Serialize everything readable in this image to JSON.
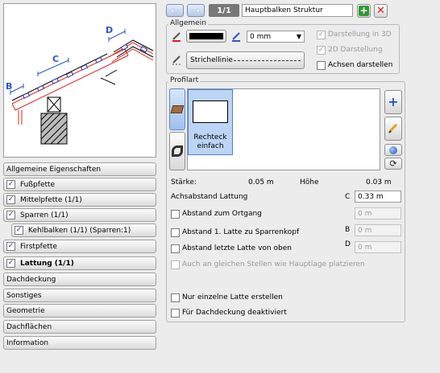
{
  "header": {
    "page_indicator": "1/1",
    "title_value": "Hauptbalken Struktur",
    "back_icon": "arrow-left-icon",
    "forward_icon": "arrow-right-icon",
    "add_icon": "plus-icon",
    "delete_icon": "x-icon"
  },
  "preview": {
    "labels": {
      "a": "A",
      "b": "B",
      "c": "C",
      "d": "D"
    }
  },
  "sidebar": {
    "items": [
      {
        "label": "Allgemeine Eigenschaften",
        "checkbox": false,
        "bold": false
      },
      {
        "label": "Fußpfette",
        "checkbox": true,
        "checked": true,
        "bold": false
      },
      {
        "label": "Mittelpfette (1/1)",
        "checkbox": true,
        "checked": true,
        "bold": false
      },
      {
        "label": "Sparren (1/1)",
        "checkbox": true,
        "checked": true,
        "bold": false
      },
      {
        "label": "Kehlbalken (1/1) (Sparren:1)",
        "checkbox": true,
        "checked": true,
        "bold": false
      },
      {
        "label": "Firstpfette",
        "checkbox": true,
        "checked": true,
        "bold": false
      },
      {
        "label": "Lattung (1/1)",
        "checkbox": true,
        "checked": true,
        "bold": true
      },
      {
        "label": "Dachdeckung",
        "checkbox": false,
        "bold": false
      },
      {
        "label": "Sonstiges",
        "checkbox": false,
        "bold": false
      },
      {
        "label": "Geometrie",
        "checkbox": false,
        "bold": false
      },
      {
        "label": "Dachflächen",
        "checkbox": false,
        "bold": false
      },
      {
        "label": "Information",
        "checkbox": false,
        "bold": false
      }
    ]
  },
  "allgemein": {
    "title": "Allgemein",
    "pen_color": "#000000",
    "pen_width_value": "0 mm",
    "line_style_label": "Strichellinie",
    "darstellung_3d": "Darstellung in 3D",
    "darstellung_2d": "2D Darstellung",
    "achsen": "Achsen darstellen"
  },
  "profilart": {
    "title": "Profilart",
    "tile_line1": "Rechteck",
    "tile_line2": "einfach",
    "staerke_label": "Stärke:",
    "staerke_value": "0.05 m",
    "hoehe_label": "Höhe",
    "hoehe_value": "0.03 m"
  },
  "options": {
    "achsabstand_label": "Achsabstand Lattung",
    "achsabstand_letter": "C",
    "achsabstand_value": "0.33 m",
    "ortgang_label": "Abstand zum Ortgang",
    "ortgang_value": "0 m",
    "latte1_label": "Abstand 1. Latte zu Sparrenkopf",
    "latte1_letter": "B",
    "latte1_value": "0 m",
    "letzte_label": "Abstand letzte Latte von oben",
    "letzte_letter": "D",
    "letzte_value": "0 m",
    "hauptlage_label": "Auch an gleichen Stellen wie Hauptlage platzieren",
    "einzelne_label": "Nur einzelne Latte erstellen",
    "dachdeckung_label": "Für Dachdeckung deaktiviert"
  },
  "colors": {
    "accent_blue": "#2a56c6",
    "selected_blue": "#bcd4f5",
    "drawing_red": "#e02020",
    "add_green": "#2f9a2f",
    "delete_red": "#d42020"
  }
}
